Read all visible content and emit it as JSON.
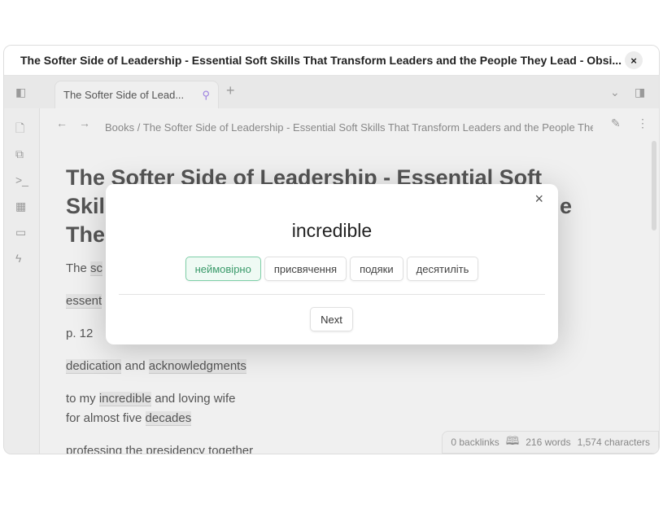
{
  "window": {
    "title": "The Softer Side of Leadership - Essential Soft Skills That Transform Leaders and the People They Lead - Obsi...",
    "close": "×"
  },
  "tabs": [
    {
      "label": "The Softer Side of Lead...",
      "pinned": true
    }
  ],
  "new_tab": "+",
  "breadcrumb": {
    "folder": "Books",
    "sep": "/",
    "file": "The Softer Side of Leadership - Essential Soft Skills That Transform Leaders and the People They Lead"
  },
  "doc": {
    "title": "The Softer Side of Leadership - Essential Soft Skills That Transform Leaders and the People They Lead",
    "title_line1": "The Softer Side of Leadership - Essential Soft",
    "title_line2a": "Skil",
    "title_line2b": "e",
    "title_line3": "The",
    "p1a": "The ",
    "p1b": "sc",
    "p2": "essent",
    "p3": "p. 12",
    "p4": [
      "dedication",
      " and ",
      "acknowledgments"
    ],
    "p5": [
      "to my ",
      "incredible",
      " and loving wife"
    ],
    "p6": [
      "for almost five ",
      "decades"
    ],
    "p7": "professing the presidency together"
  },
  "status": {
    "backlinks": "0 backlinks",
    "words": "216 words",
    "characters": "1,574 characters"
  },
  "modal": {
    "word": "incredible",
    "options": [
      "неймовірно",
      "присвячення",
      "подяки",
      "десятиліть"
    ],
    "selected": 0,
    "next": "Next",
    "close": "×"
  },
  "colors": {
    "accent": "#9b7fe0",
    "selected_option": "#3a9a6a"
  }
}
